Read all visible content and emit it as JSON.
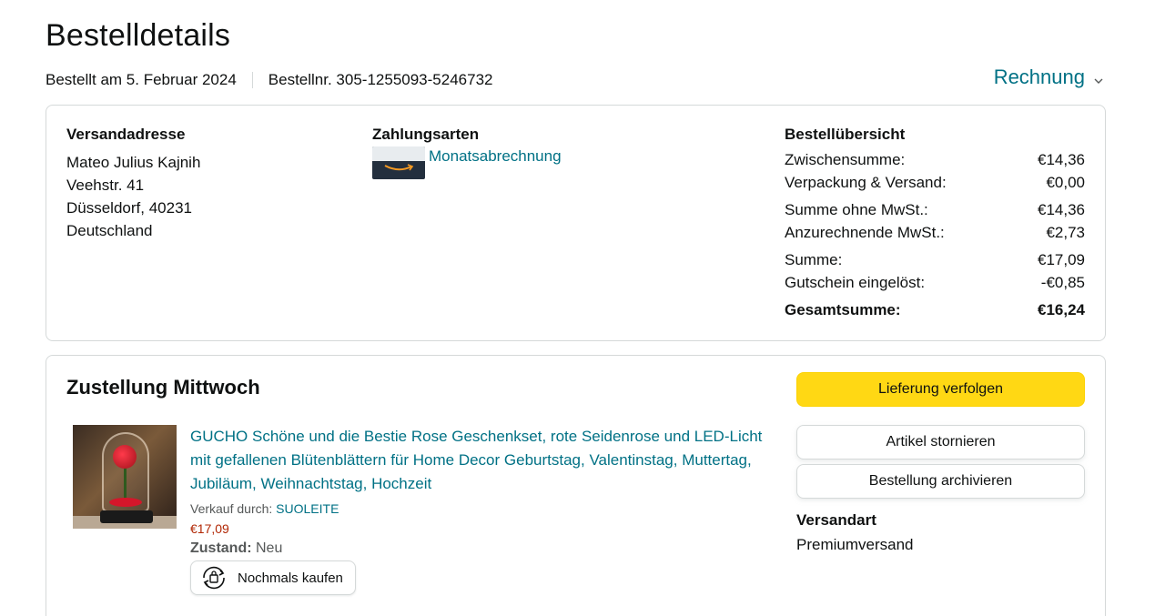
{
  "header": {
    "title": "Bestelldetails",
    "ordered_on": "Bestellt am 5. Februar 2024",
    "order_number": "Bestellnr. 305-1255093-5246732",
    "invoice_label": "Rechnung"
  },
  "shipping_address": {
    "heading": "Versandadresse",
    "name": "Mateo Julius Kajnih",
    "street": "Veehstr. 41",
    "city": "Düsseldorf, 40231",
    "country": "Deutschland"
  },
  "payment": {
    "heading": "Zahlungsarten",
    "method": "Monatsabrechnung"
  },
  "summary": {
    "heading": "Bestellübersicht",
    "rows": [
      {
        "label": "Zwischensumme:",
        "value": "€14,36"
      },
      {
        "label": "Verpackung & Versand:",
        "value": "€0,00"
      },
      {
        "label": "Summe ohne MwSt.:",
        "value": "€14,36"
      },
      {
        "label": "Anzurechnende MwSt.:",
        "value": "€2,73"
      },
      {
        "label": "Summe:",
        "value": "€17,09"
      },
      {
        "label": "Gutschein eingelöst:",
        "value": "-€0,85"
      }
    ],
    "total_label": "Gesamtsumme:",
    "total_value": "€16,24"
  },
  "delivery": {
    "heading": "Zustellung Mittwoch",
    "item": {
      "title": "GUCHO Schöne und die Bestie Rose Geschenkset, rote Seidenrose und LED-Licht mit gefallenen Blütenblättern für Home Decor Geburtstag, Valentinstag, Muttertag, Jubiläum, Weihnachtstag, Hochzeit",
      "sold_by_label": "Verkauf durch:",
      "seller": "SUOLEITE",
      "price": "€17,09",
      "condition_label": "Zustand:",
      "condition": "Neu",
      "buy_again_label": "Nochmals kaufen"
    },
    "buttons": {
      "track": "Lieferung verfolgen",
      "cancel": "Artikel stornieren",
      "archive": "Bestellung archivieren"
    },
    "shipping_type_heading": "Versandart",
    "shipping_type": "Premiumversand"
  },
  "colors": {
    "link": "#007185",
    "price": "#b12704",
    "primary_button": "#ffd814",
    "border": "#d5d9d9"
  }
}
